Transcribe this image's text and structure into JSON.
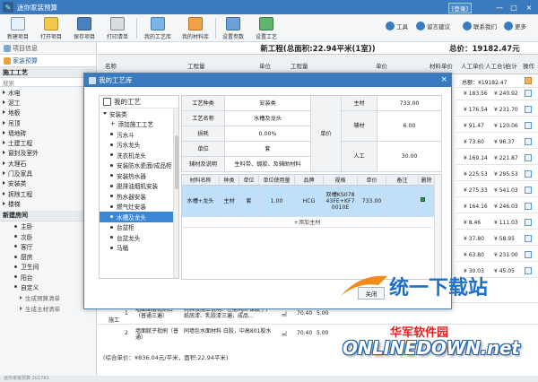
{
  "window": {
    "title": "迷你家装预算",
    "login": "[登录]",
    "controls": [
      "—",
      "□",
      "×"
    ]
  },
  "toolbar": {
    "buttons": [
      {
        "label": "新建项目",
        "icon": "new-project-icon"
      },
      {
        "label": "打开项目",
        "icon": "open-folder-icon"
      },
      {
        "label": "保存项目",
        "icon": "save-icon"
      },
      {
        "label": "打印清单",
        "icon": "printer-icon"
      },
      {
        "label": "我的工艺库",
        "icon": "craft-library-icon"
      },
      {
        "label": "我的材料库",
        "icon": "material-library-icon"
      },
      {
        "label": "设置参数",
        "icon": "settings-icon"
      },
      {
        "label": "设置工艺",
        "icon": "craft-settings-icon"
      }
    ],
    "right": [
      {
        "label": "工具",
        "icon": "tools-icon"
      },
      {
        "label": "留言建议",
        "icon": "message-icon"
      },
      {
        "label": "联系我们",
        "icon": "contact-icon"
      },
      {
        "label": "更多",
        "icon": "more-icon"
      }
    ]
  },
  "left_panel": {
    "tabs": [
      "项目信息",
      "家装预算"
    ],
    "section": "施工工艺",
    "search_placeholder": "搜索",
    "categories": [
      "水电",
      "泥工",
      "地板",
      "吊顶",
      "墙地砖",
      "土建工程",
      "窗封及室外",
      "大理石",
      "门及家具",
      "安装类",
      "拆除工程",
      "楼梯"
    ],
    "rooms_section": "新建房间",
    "rooms": [
      "主卧",
      "次卧",
      "客厅",
      "厨房",
      "卫生间",
      "阳台",
      "自定义"
    ],
    "footer": [
      "生成预算清单",
      "生成主材清单"
    ]
  },
  "content": {
    "title": "新工程(总面积:22.94平米(1室))",
    "total": "总价：19182.47元",
    "headers": [
      "名称",
      "工程量",
      "单位",
      "工程量",
      "单价",
      "材料单价",
      "人工单价",
      "人工合计",
      "合计",
      "操作"
    ],
    "summary": "总额：¥19182.47",
    "right_rows": [
      [
        "¥ 183.56",
        "¥ 240.92"
      ],
      [
        "¥ 176.54",
        "¥ 231.70"
      ],
      [
        "¥ 91.47",
        "¥ 120.06"
      ],
      [
        "¥ 73.60",
        "¥ 96.37"
      ],
      [
        "¥ 169.14",
        "¥ 221.87"
      ],
      [
        "¥ 225.53",
        "¥ 295.53"
      ],
      [
        "¥ 275.33",
        "¥ 541.03"
      ],
      [
        "¥ 164.16",
        "¥ 246.03"
      ],
      [
        "¥ 8.46",
        "¥ 111.03"
      ],
      [
        "¥ 37.80",
        "¥ 58.95"
      ],
      [
        "¥ 63.80",
        "¥ 231.00"
      ],
      [
        "¥ 30.03",
        "¥ 45.05"
      ]
    ],
    "bottom_rows": [
      {
        "idx": "1",
        "category": "施工",
        "desc": "墙面面层批刷白（普通三遍）",
        "detail": "材料及施工说明：性能MJ环保腻子，纸底漆、乳胶漆三遍，成品…",
        "unit": "㎡",
        "qty": "70.40",
        "price": "5.00"
      },
      {
        "idx": "2",
        "category": "",
        "desc": "墙面腻子批刷（普通）",
        "detail": "同墙包水面材料 白胶，中高801胶水",
        "unit": "㎡",
        "qty": "70.40",
        "price": "5.00"
      }
    ],
    "footer_sum": "(综合单价：¥836.04元/平米，面积:22.94平米)"
  },
  "dialog": {
    "title": "我的工艺库",
    "tree_title": "我的工艺",
    "tree": [
      {
        "label": "安装类",
        "level": 0,
        "type": "group"
      },
      {
        "label": "添加施工工艺",
        "level": 1,
        "type": "add"
      },
      {
        "label": "污水斗",
        "level": 1
      },
      {
        "label": "污水龙头",
        "level": 1
      },
      {
        "label": "洗衣机龙头",
        "level": 1
      },
      {
        "label": "安装防水瓷面/成品柜",
        "level": 1
      },
      {
        "label": "安装热水器",
        "level": 1
      },
      {
        "label": "脱排油烟机安装",
        "level": 1
      },
      {
        "label": "热水器安装",
        "level": 1
      },
      {
        "label": "燃气灶安装",
        "level": 1
      },
      {
        "label": "水槽及龙头",
        "level": 1,
        "selected": true
      },
      {
        "label": "台盆柜",
        "level": 1
      },
      {
        "label": "台盆龙头",
        "level": 1
      },
      {
        "label": "马桶",
        "level": 1
      }
    ],
    "info": {
      "craft_type_label": "工艺种类",
      "craft_type": "安装类",
      "craft_name_label": "工艺名称",
      "craft_name": "水槽及龙头",
      "loss_label": "损耗",
      "loss": "0.00%",
      "unit_label": "单位",
      "unit": "套",
      "desc_label": "辅材及说明",
      "desc": "生料带、镀胶、及辅助材料",
      "price_label": "单价",
      "main_label": "主材",
      "main_value": "733.00",
      "aux_label": "辅材",
      "aux_value": "6.00",
      "labor_label": "人工",
      "labor_value": "30.00"
    },
    "grid_headers": [
      "材料名称",
      "种类",
      "单位",
      "单位使用量",
      "品牌",
      "规格",
      "单价",
      "备注",
      "删除"
    ],
    "grid_row": [
      "水槽+龙头",
      "主材",
      "套",
      "1.00",
      "HCG",
      "双槽KS07843FE+KF70010E",
      "733.00",
      "",
      ""
    ],
    "add_row": "+添加主材",
    "close_button": "关闭"
  },
  "watermark": {
    "line1": "统一下载站",
    "line2": "华军软件园",
    "line3": "ONLINEDOWN.net"
  },
  "statusline": "迷你家装预算 2017R1"
}
